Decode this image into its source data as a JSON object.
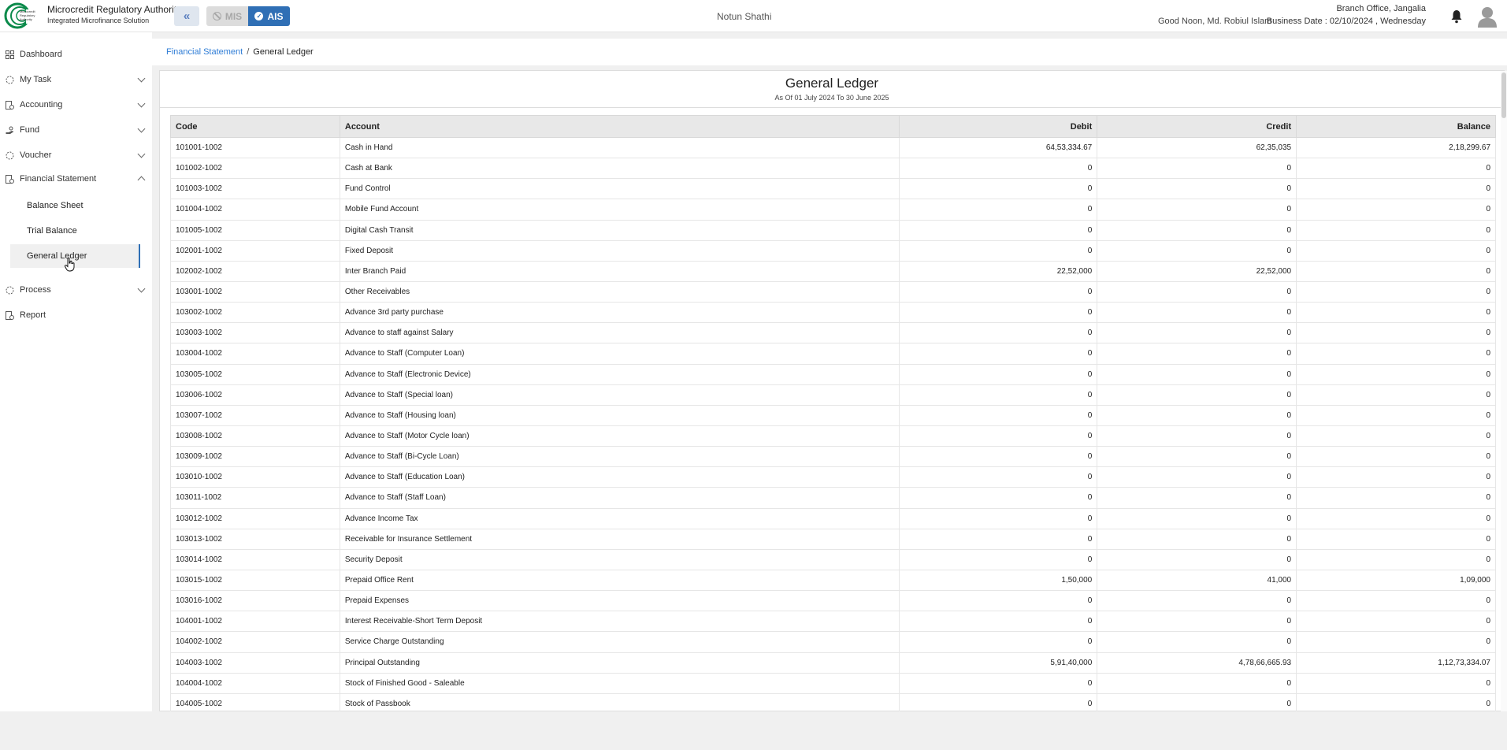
{
  "header": {
    "org_name": "Microcredit Regulatory Authority",
    "org_sub": "Integrated Microfinance Solution",
    "logo_text": "Microcredit Regulatory Authority",
    "mis_label": "MIS",
    "ais_label": "AIS",
    "center_title": "Notun Shathi",
    "greeting": "Good Noon, Md. Robiul Islam",
    "branch": "Branch Office, Jangalia",
    "business_date": "Business Date : 02/10/2024 , Wednesday"
  },
  "sidebar": {
    "items": [
      {
        "label": "Dashboard",
        "icon": "grid-icon"
      },
      {
        "label": "My Task",
        "icon": "task-icon"
      },
      {
        "label": "Accounting",
        "icon": "accounting-icon"
      },
      {
        "label": "Fund",
        "icon": "hand-money-icon"
      },
      {
        "label": "Voucher",
        "icon": "voucher-icon"
      },
      {
        "label": "Financial Statement",
        "icon": "statement-icon"
      },
      {
        "label": "Process",
        "icon": "process-icon"
      },
      {
        "label": "Report",
        "icon": "report-icon"
      }
    ],
    "sub_items": [
      "Balance Sheet",
      "Trial Balance",
      "General Ledger"
    ]
  },
  "breadcrumb": {
    "parent": "Financial Statement",
    "separator": "/",
    "current": "General Ledger"
  },
  "report": {
    "title": "General Ledger",
    "subtitle": "As Of 01 July 2024 To 30 June 2025",
    "columns": [
      "Code",
      "Account",
      "Debit",
      "Credit",
      "Balance"
    ],
    "rows": [
      [
        "101001-1002",
        "Cash in Hand",
        "64,53,334.67",
        "62,35,035",
        "2,18,299.67"
      ],
      [
        "101002-1002",
        "Cash at Bank",
        "0",
        "0",
        "0"
      ],
      [
        "101003-1002",
        "Fund Control",
        "0",
        "0",
        "0"
      ],
      [
        "101004-1002",
        "Mobile Fund Account",
        "0",
        "0",
        "0"
      ],
      [
        "101005-1002",
        "Digital Cash Transit",
        "0",
        "0",
        "0"
      ],
      [
        "102001-1002",
        "Fixed Deposit",
        "0",
        "0",
        "0"
      ],
      [
        "102002-1002",
        "Inter Branch Paid",
        "22,52,000",
        "22,52,000",
        "0"
      ],
      [
        "103001-1002",
        "Other Receivables",
        "0",
        "0",
        "0"
      ],
      [
        "103002-1002",
        "Advance 3rd party purchase",
        "0",
        "0",
        "0"
      ],
      [
        "103003-1002",
        "Advance to staff against Salary",
        "0",
        "0",
        "0"
      ],
      [
        "103004-1002",
        "Advance to Staff (Computer Loan)",
        "0",
        "0",
        "0"
      ],
      [
        "103005-1002",
        "Advance to Staff (Electronic Device)",
        "0",
        "0",
        "0"
      ],
      [
        "103006-1002",
        "Advance to Staff (Special loan)",
        "0",
        "0",
        "0"
      ],
      [
        "103007-1002",
        "Advance to Staff (Housing loan)",
        "0",
        "0",
        "0"
      ],
      [
        "103008-1002",
        "Advance to Staff (Motor Cycle loan)",
        "0",
        "0",
        "0"
      ],
      [
        "103009-1002",
        "Advance to Staff (Bi-Cycle Loan)",
        "0",
        "0",
        "0"
      ],
      [
        "103010-1002",
        "Advance to Staff (Education Loan)",
        "0",
        "0",
        "0"
      ],
      [
        "103011-1002",
        "Advance to Staff (Staff Loan)",
        "0",
        "0",
        "0"
      ],
      [
        "103012-1002",
        "Advance Income Tax",
        "0",
        "0",
        "0"
      ],
      [
        "103013-1002",
        "Receivable for Insurance Settlement",
        "0",
        "0",
        "0"
      ],
      [
        "103014-1002",
        "Security Deposit",
        "0",
        "0",
        "0"
      ],
      [
        "103015-1002",
        "Prepaid Office Rent",
        "1,50,000",
        "41,000",
        "1,09,000"
      ],
      [
        "103016-1002",
        "Prepaid Expenses",
        "0",
        "0",
        "0"
      ],
      [
        "104001-1002",
        "Interest Receivable-Short Term Deposit",
        "0",
        "0",
        "0"
      ],
      [
        "104002-1002",
        "Service Charge Outstanding",
        "0",
        "0",
        "0"
      ],
      [
        "104003-1002",
        "Principal Outstanding",
        "5,91,40,000",
        "4,78,66,665.93",
        "1,12,73,334.07"
      ],
      [
        "104004-1002",
        "Stock of Finished Good - Saleable",
        "0",
        "0",
        "0"
      ],
      [
        "104005-1002",
        "Stock of Passbook",
        "0",
        "0",
        "0"
      ]
    ]
  },
  "colors": {
    "accent": "#2f6fb5",
    "link": "#2f7dd6",
    "logo_green": "#0a8a4a"
  }
}
